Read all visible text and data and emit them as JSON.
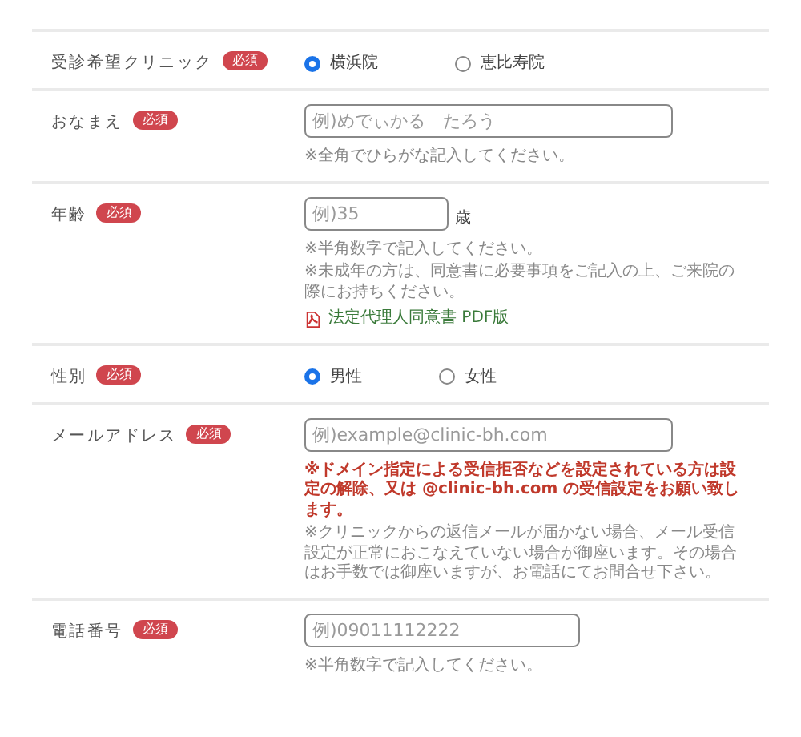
{
  "fields": [
    {
      "label": "受診希望クリニック",
      "badge": "必須",
      "kind": "radio",
      "options": [
        {
          "label": "横浜院",
          "selected": true
        },
        {
          "label": "恵比寿院",
          "selected": false
        }
      ]
    },
    {
      "label": "おなまえ",
      "badge": "必須",
      "kind": "text",
      "placeholder": "例)めでぃかる　たろう",
      "notes": [
        {
          "kind": "plain",
          "text": "※全角でひらがな記入してください。"
        }
      ]
    },
    {
      "label": "年齢",
      "badge": "必須",
      "kind": "text",
      "short": true,
      "placeholder": "例)35",
      "suffix": "歳",
      "notes": [
        {
          "kind": "plain",
          "text": "※半角数字で記入してください。"
        },
        {
          "kind": "plain",
          "text": "※未成年の方は、同意書に必要事項をご記入の上、ご来院の際にお持ちください。"
        },
        {
          "kind": "link",
          "text": "法定代理人同意書 PDF版"
        }
      ]
    },
    {
      "label": "性別",
      "badge": "必須",
      "kind": "radio",
      "options": [
        {
          "label": "男性",
          "selected": true
        },
        {
          "label": "女性",
          "selected": false
        }
      ]
    },
    {
      "label": "メールアドレス",
      "badge": "必須",
      "kind": "text",
      "placeholder": "例)example@clinic-bh.com",
      "notes": [
        {
          "kind": "warning",
          "text": "※ドメイン指定による受信拒否などを設定されている方は設定の解除、又は @clinic-bh.com の受信設定をお願い致します。"
        },
        {
          "kind": "plain",
          "text": "※クリニックからの返信メールが届かない場合、メール受信設定が正常におこなえていない場合が御座います。その場合はお手数では御座いますが、お電話にてお問合せ下さい。"
        }
      ]
    },
    {
      "label": "電話番号",
      "badge": "必須",
      "kind": "text",
      "medium": true,
      "placeholder": "例)09011112222",
      "notes": [
        {
          "kind": "plain",
          "text": "※半角数字で記入してください。"
        }
      ]
    }
  ]
}
